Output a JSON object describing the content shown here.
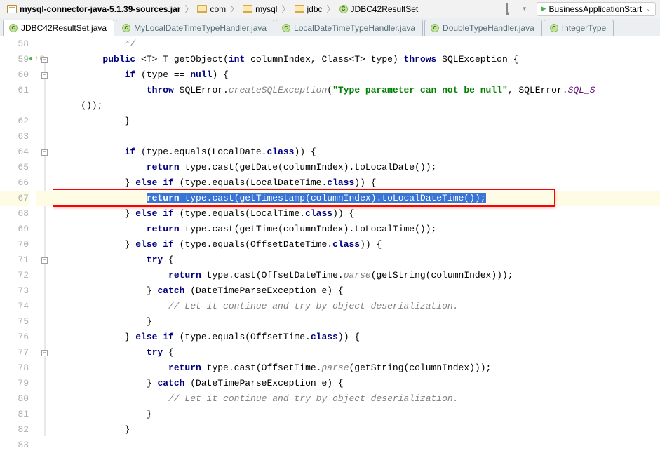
{
  "breadcrumb": {
    "items": [
      {
        "icon": "jar",
        "label": "mysql-connector-java-5.1.39-sources.jar",
        "bold": true
      },
      {
        "icon": "folder",
        "label": "com"
      },
      {
        "icon": "folder",
        "label": "mysql"
      },
      {
        "icon": "folder",
        "label": "jdbc"
      },
      {
        "icon": "class",
        "label": "JDBC42ResultSet"
      }
    ]
  },
  "run_config": {
    "label": "BusinessApplicationStart"
  },
  "tabs": [
    {
      "label": "JDBC42ResultSet.java",
      "active": true
    },
    {
      "label": "MyLocalDateTimeTypeHandler.java",
      "active": false
    },
    {
      "label": "LocalDateTimeTypeHandler.java",
      "active": false
    },
    {
      "label": "DoubleTypeHandler.java",
      "active": false
    },
    {
      "label": "IntegerType",
      "active": false,
      "cut": true
    }
  ],
  "gutter": {
    "start": 58,
    "end": 83,
    "highlight": 67,
    "override_line": 59
  },
  "code": {
    "l58": {
      "comment": "*/"
    },
    "l59": {
      "kw1": "public",
      "gen1": "<",
      "gen2": "T",
      "gen3": ">",
      "ret": "T",
      "name": "getObject(",
      "kw2": "int",
      "p1": " columnIndex, Class<",
      "gen4": "T",
      "p2": "> type) ",
      "kw3": "throws",
      "exc": " SQLException {"
    },
    "l60": {
      "kw": "if",
      "cond": " (type == ",
      "kw2": "null",
      "tail": ") {"
    },
    "l61": {
      "kw": "throw",
      "s1": " SQLError.",
      "method": "createSQLException",
      "paren": "(",
      "str": "\"Type parameter can not be null\"",
      "tail": ", SQLError.",
      "ref": "SQL_S"
    },
    "l61b": "());",
    "l62": "}",
    "l64": {
      "kw": "if",
      "cond": " (type.equals(LocalDate.",
      "kw2": "class",
      "tail": ")) {"
    },
    "l65": {
      "kw": "return",
      "body": " type.cast(getDate(columnIndex).toLocalDate());"
    },
    "l66": {
      "br": "} ",
      "kw": "else if",
      "cond": " (type.equals(LocalDateTime.",
      "kw2": "class",
      "tail": ")) {"
    },
    "l67": {
      "kw": "return",
      "body": " type.cast(getTimestamp(columnIndex).toLocalDateTime());"
    },
    "l68": {
      "br": "} ",
      "kw": "else if",
      "cond": " (type.equals(LocalTime.",
      "kw2": "class",
      "tail": ")) {"
    },
    "l69": {
      "kw": "return",
      "body": " type.cast(getTime(columnIndex).toLocalTime());"
    },
    "l70": {
      "br": "} ",
      "kw": "else if",
      "cond": " (type.equals(OffsetDateTime.",
      "kw2": "class",
      "tail": ")) {"
    },
    "l71": {
      "kw": "try",
      "tail": " {"
    },
    "l72": {
      "kw": "return",
      "s1": " type.cast(OffsetDateTime.",
      "method": "parse",
      "tail": "(getString(columnIndex)));"
    },
    "l73": {
      "br": "} ",
      "kw": "catch",
      "cond": " (DateTimeParseException e) {"
    },
    "l74": {
      "comment": "// Let it continue and try by object deserialization."
    },
    "l75": "}",
    "l76": {
      "br": "} ",
      "kw": "else if",
      "cond": " (type.equals(OffsetTime.",
      "kw2": "class",
      "tail": ")) {"
    },
    "l77": {
      "kw": "try",
      "tail": " {"
    },
    "l78": {
      "kw": "return",
      "s1": " type.cast(OffsetTime.",
      "method": "parse",
      "tail": "(getString(columnIndex)));"
    },
    "l79": {
      "br": "} ",
      "kw": "catch",
      "cond": " (DateTimeParseException e) {"
    },
    "l80": {
      "comment": "// Let it continue and try by object deserialization."
    },
    "l81": "}",
    "l82": "}"
  }
}
